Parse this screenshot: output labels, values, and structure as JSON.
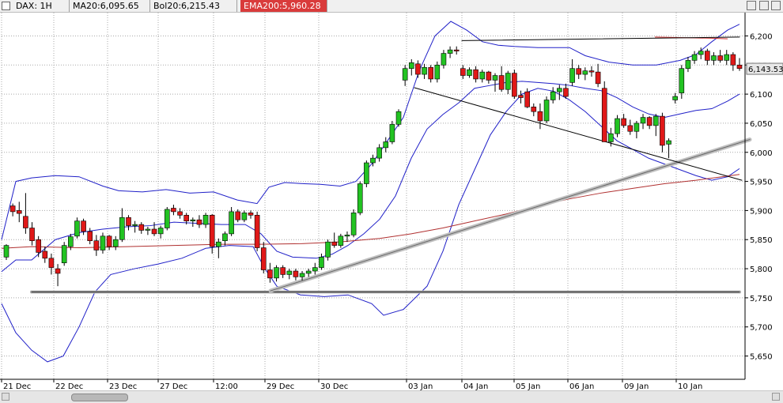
{
  "header": {
    "symbol_label": "DAX: 1H",
    "ma_label": "MA20:6,095.65",
    "bol_label": "Bol20:6,215.43",
    "ema_label": "EMA200:5,960.28"
  },
  "chart_data": {
    "type": "candlestick",
    "ylim": [
      5610,
      6240
    ],
    "y_ticks": [
      "6,200",
      "6,150",
      "6,100",
      "6,050",
      "6,000",
      "5,950",
      "5,900",
      "5,850",
      "5,800",
      "5,750",
      "5,700",
      "5,650"
    ],
    "last_price_label": "6,143.53",
    "x_labels": [
      "21 Dec",
      "22 Dec",
      "23 Dec",
      "27 Dec",
      "12:00",
      "29 Dec",
      "30 Dec",
      "03 Jan",
      "04 Jan",
      "05 Jan",
      "06 Jan",
      "09 Jan",
      "10 Jan"
    ],
    "candles": [
      [
        5820,
        5842,
        5815,
        5840
      ],
      [
        5908,
        5912,
        5890,
        5898
      ],
      [
        5900,
        5915,
        5880,
        5895
      ],
      [
        5890,
        5930,
        5860,
        5870
      ],
      [
        5870,
        5880,
        5840,
        5848
      ],
      [
        5850,
        5856,
        5820,
        5828
      ],
      [
        5830,
        5838,
        5810,
        5818
      ],
      [
        5818,
        5826,
        5790,
        5802
      ],
      [
        5800,
        5808,
        5770,
        5792
      ],
      [
        5810,
        5846,
        5805,
        5840
      ],
      [
        5838,
        5860,
        5832,
        5855
      ],
      [
        5856,
        5888,
        5852,
        5882
      ],
      [
        5882,
        5886,
        5858,
        5864
      ],
      [
        5864,
        5870,
        5842,
        5848
      ],
      [
        5848,
        5858,
        5822,
        5832
      ],
      [
        5832,
        5862,
        5826,
        5856
      ],
      [
        5856,
        5858,
        5832,
        5838
      ],
      [
        5838,
        5856,
        5832,
        5850
      ],
      [
        5850,
        5904,
        5846,
        5888
      ],
      [
        5888,
        5892,
        5866,
        5874
      ],
      [
        5874,
        5882,
        5862,
        5876
      ],
      [
        5876,
        5880,
        5860,
        5866
      ],
      [
        5866,
        5872,
        5858,
        5868
      ],
      [
        5868,
        5880,
        5856,
        5860
      ],
      [
        5860,
        5874,
        5852,
        5870
      ],
      [
        5870,
        5906,
        5866,
        5902
      ],
      [
        5904,
        5910,
        5892,
        5898
      ],
      [
        5898,
        5904,
        5886,
        5892
      ],
      [
        5892,
        5896,
        5876,
        5882
      ],
      [
        5882,
        5888,
        5872,
        5884
      ],
      [
        5884,
        5892,
        5870,
        5876
      ],
      [
        5876,
        5896,
        5870,
        5892
      ],
      [
        5892,
        5894,
        5826,
        5838
      ],
      [
        5838,
        5852,
        5818,
        5846
      ],
      [
        5848,
        5864,
        5840,
        5860
      ],
      [
        5860,
        5906,
        5856,
        5898
      ],
      [
        5898,
        5902,
        5880,
        5884
      ],
      [
        5884,
        5900,
        5880,
        5896
      ],
      [
        5896,
        5900,
        5886,
        5892
      ],
      [
        5892,
        5898,
        5830,
        5836
      ],
      [
        5836,
        5846,
        5792,
        5798
      ],
      [
        5798,
        5810,
        5776,
        5784
      ],
      [
        5784,
        5806,
        5778,
        5802
      ],
      [
        5802,
        5806,
        5784,
        5790
      ],
      [
        5790,
        5800,
        5782,
        5796
      ],
      [
        5796,
        5800,
        5780,
        5786
      ],
      [
        5786,
        5796,
        5780,
        5792
      ],
      [
        5792,
        5800,
        5786,
        5796
      ],
      [
        5796,
        5810,
        5790,
        5802
      ],
      [
        5802,
        5826,
        5798,
        5820
      ],
      [
        5820,
        5850,
        5814,
        5846
      ],
      [
        5846,
        5862,
        5836,
        5840
      ],
      [
        5840,
        5860,
        5836,
        5856
      ],
      [
        5856,
        5864,
        5846,
        5858
      ],
      [
        5858,
        5902,
        5854,
        5896
      ],
      [
        5896,
        5950,
        5892,
        5946
      ],
      [
        5946,
        5986,
        5940,
        5982
      ],
      [
        5982,
        5996,
        5976,
        5990
      ],
      [
        5990,
        6014,
        5984,
        6008
      ],
      [
        6008,
        6026,
        6000,
        6018
      ],
      [
        6018,
        6054,
        6014,
        6048
      ],
      [
        6048,
        6074,
        6044,
        6070
      ],
      [
        6124,
        6150,
        6114,
        6144
      ],
      [
        6144,
        6160,
        6132,
        6154
      ],
      [
        6152,
        6158,
        6128,
        6134
      ],
      [
        6134,
        6152,
        6126,
        6146
      ],
      [
        6146,
        6150,
        6120,
        6126
      ],
      [
        6126,
        6156,
        6120,
        6150
      ],
      [
        6150,
        6176,
        6144,
        6170
      ],
      [
        6170,
        6182,
        6162,
        6176
      ],
      [
        6176,
        6182,
        6168,
        6174
      ],
      [
        6144,
        6150,
        6126,
        6132
      ],
      [
        6132,
        6146,
        6128,
        6142
      ],
      [
        6142,
        6148,
        6120,
        6126
      ],
      [
        6126,
        6142,
        6120,
        6138
      ],
      [
        6138,
        6140,
        6118,
        6124
      ],
      [
        6124,
        6136,
        6104,
        6132
      ],
      [
        6132,
        6148,
        6104,
        6108
      ],
      [
        6108,
        6140,
        6100,
        6136
      ],
      [
        6136,
        6142,
        6092,
        6096
      ],
      [
        6098,
        6106,
        6084,
        6094
      ],
      [
        6104,
        6110,
        6076,
        6078
      ],
      [
        6078,
        6084,
        6062,
        6070
      ],
      [
        6070,
        6084,
        6040,
        6054
      ],
      [
        6054,
        6096,
        6050,
        6090
      ],
      [
        6090,
        6112,
        6084,
        6104
      ],
      [
        6104,
        6116,
        6090,
        6110
      ],
      [
        6110,
        6118,
        6092,
        6096
      ],
      [
        6120,
        6160,
        6114,
        6144
      ],
      [
        6144,
        6150,
        6126,
        6134
      ],
      [
        6134,
        6146,
        6124,
        6140
      ],
      [
        6140,
        6148,
        6130,
        6138
      ],
      [
        6138,
        6152,
        6112,
        6118
      ],
      [
        6110,
        6122,
        6030,
        6018
      ],
      [
        6018,
        6042,
        6010,
        6032
      ],
      [
        6032,
        6064,
        6026,
        6058
      ],
      [
        6058,
        6066,
        6042,
        6046
      ],
      [
        6046,
        6056,
        6030,
        6036
      ],
      [
        6036,
        6054,
        6024,
        6050
      ],
      [
        6050,
        6066,
        6040,
        6060
      ],
      [
        6060,
        6062,
        6040,
        6046
      ],
      [
        6046,
        6066,
        6028,
        6062
      ],
      [
        6062,
        6068,
        6000,
        6012
      ],
      [
        6014,
        6024,
        5990,
        6020
      ],
      [
        6090,
        6102,
        6084,
        6096
      ],
      [
        6102,
        6150,
        6092,
        6144
      ],
      [
        6144,
        6164,
        6138,
        6158
      ],
      [
        6158,
        6174,
        6152,
        6168
      ],
      [
        6168,
        6180,
        6160,
        6174
      ],
      [
        6174,
        6178,
        6150,
        6158
      ],
      [
        6158,
        6172,
        6150,
        6166
      ],
      [
        6166,
        6176,
        6154,
        6158
      ],
      [
        6158,
        6176,
        6150,
        6168
      ],
      [
        6168,
        6172,
        6140,
        6150
      ],
      [
        6150,
        6162,
        6140,
        6144
      ]
    ]
  }
}
